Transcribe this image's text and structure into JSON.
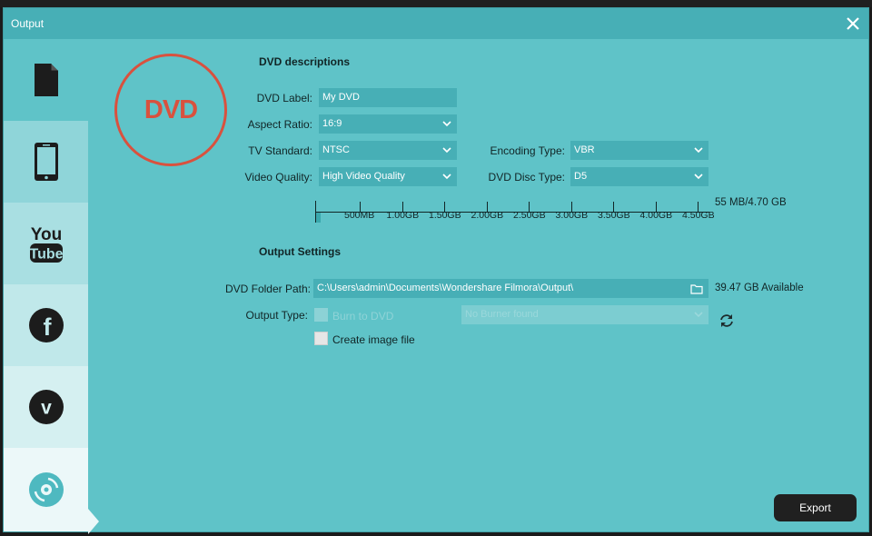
{
  "window": {
    "title": "Output"
  },
  "sidebar": {
    "items": [
      {
        "icon": "document-icon"
      },
      {
        "icon": "phone-icon"
      },
      {
        "icon": "youtube-icon"
      },
      {
        "icon": "facebook-icon"
      },
      {
        "icon": "vimeo-icon"
      },
      {
        "icon": "dvd-disc-icon",
        "active": true
      }
    ]
  },
  "badge": {
    "text": "DVD"
  },
  "dvd_descriptions": {
    "title": "DVD descriptions",
    "label_label": "DVD Label:",
    "label_value": "My DVD",
    "aspect_label": "Aspect Ratio:",
    "aspect_value": "16:9",
    "tv_label": "TV Standard:",
    "tv_value": "NTSC",
    "encoding_label": "Encoding Type:",
    "encoding_value": "VBR",
    "quality_label": "Video Quality:",
    "quality_value": "High Video Quality",
    "disc_label": "DVD Disc Type:",
    "disc_value": "D5"
  },
  "capacity": {
    "ticks": [
      "500MB",
      "1.00GB",
      "1.50GB",
      "2.00GB",
      "2.50GB",
      "3.00GB",
      "3.50GB",
      "4.00GB",
      "4.50GB"
    ],
    "used_fraction": 0.012,
    "summary": "55 MB/4.70 GB"
  },
  "output_settings": {
    "title": "Output Settings",
    "folder_label": "DVD Folder Path:",
    "folder_value": "C:\\Users\\admin\\Documents\\Wondershare Filmora\\Output\\",
    "available": "39.47 GB Available",
    "type_label": "Output Type:",
    "burn_label": "Burn to DVD",
    "burner_value": "No Burner found",
    "image_label": "Create image file"
  },
  "actions": {
    "export_label": "Export"
  },
  "colors": {
    "accent": "#47afb6",
    "panel": "#5fc3c8",
    "dvd_red": "#d9513e",
    "button": "#202020"
  }
}
